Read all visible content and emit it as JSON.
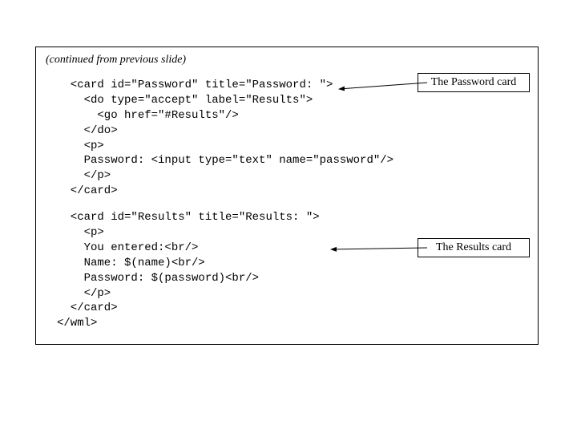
{
  "caption": "(continued from previous slide)",
  "code": {
    "block1": "  <card id=\"Password\" title=\"Password: \">\n    <do type=\"accept\" label=\"Results\">\n      <go href=\"#Results\"/>\n    </do>\n    <p>\n    Password: <input type=\"text\" name=\"password\"/>\n    </p>\n  </card>",
    "block2": "  <card id=\"Results\" title=\"Results: \">\n    <p>\n    You entered:<br/>\n    Name: $(name)<br/>\n    Password: $(password)<br/>\n    </p>\n  </card>\n</wml>"
  },
  "labels": {
    "password": "The Password card",
    "results": "The Results card"
  }
}
